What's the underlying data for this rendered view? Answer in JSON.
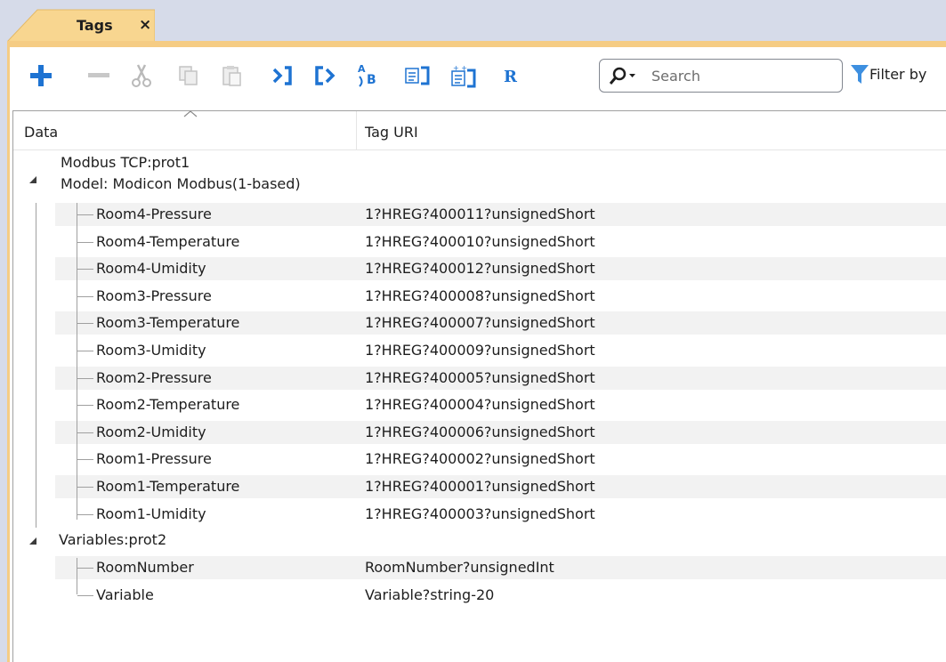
{
  "tab": {
    "label": "Tags",
    "close": "×"
  },
  "toolbar": {
    "icons": [
      {
        "name": "add-icon",
        "enabled": true
      },
      {
        "name": "remove-icon",
        "enabled": false
      },
      {
        "name": "cut-icon",
        "enabled": false
      },
      {
        "name": "copy-icon",
        "enabled": false
      },
      {
        "name": "paste-icon",
        "enabled": false
      },
      {
        "name": "import-tags-icon",
        "enabled": true
      },
      {
        "name": "export-tags-icon",
        "enabled": true
      },
      {
        "name": "sort-ab-icon",
        "enabled": true
      },
      {
        "name": "dictionary-icon",
        "enabled": true
      },
      {
        "name": "dictionary-all-icon",
        "enabled": true
      },
      {
        "name": "rename-icon",
        "enabled": true
      }
    ],
    "search_placeholder": "Search",
    "filter_label": "Filter by"
  },
  "grid": {
    "columns": [
      "Data",
      "Tag URI"
    ],
    "groups": [
      {
        "title_line1": "Modbus TCP:prot1",
        "title_line2": "Model: Modicon Modbus(1-based)",
        "rows": [
          {
            "name": "Room4-Pressure",
            "uri": "1?HREG?400011?unsignedShort"
          },
          {
            "name": "Room4-Temperature",
            "uri": "1?HREG?400010?unsignedShort"
          },
          {
            "name": "Room4-Umidity",
            "uri": "1?HREG?400012?unsignedShort"
          },
          {
            "name": "Room3-Pressure",
            "uri": "1?HREG?400008?unsignedShort"
          },
          {
            "name": "Room3-Temperature",
            "uri": "1?HREG?400007?unsignedShort"
          },
          {
            "name": "Room3-Umidity",
            "uri": "1?HREG?400009?unsignedShort"
          },
          {
            "name": "Room2-Pressure",
            "uri": "1?HREG?400005?unsignedShort"
          },
          {
            "name": "Room2-Temperature",
            "uri": "1?HREG?400004?unsignedShort"
          },
          {
            "name": "Room2-Umidity",
            "uri": "1?HREG?400006?unsignedShort"
          },
          {
            "name": "Room1-Pressure",
            "uri": "1?HREG?400002?unsignedShort"
          },
          {
            "name": "Room1-Temperature",
            "uri": "1?HREG?400001?unsignedShort"
          },
          {
            "name": "Room1-Umidity",
            "uri": "1?HREG?400003?unsignedShort"
          }
        ]
      },
      {
        "title_line1": "Variables:prot2",
        "rows": [
          {
            "name": "RoomNumber",
            "uri": "RoomNumber?unsignedInt"
          },
          {
            "name": "Variable",
            "uri": "Variable?string-20"
          }
        ]
      }
    ]
  },
  "colors": {
    "accent_blue": "#1e73d2",
    "tab_orange": "#f5cc84",
    "chrome": "#d6dbe9",
    "filter_blue": "#3d8fe0"
  }
}
